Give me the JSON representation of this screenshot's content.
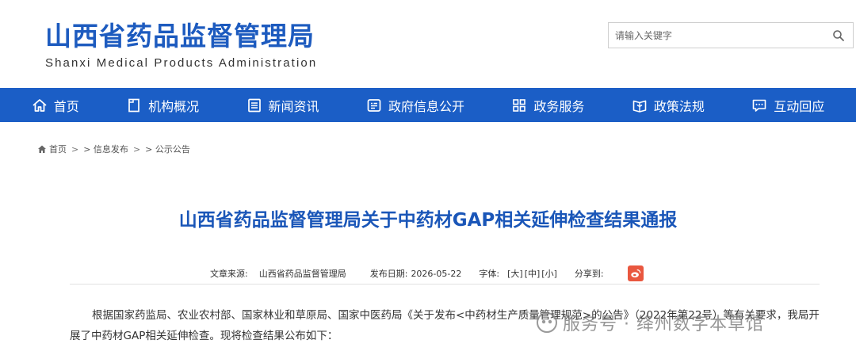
{
  "header": {
    "logo_cn": "山西省药品监督管理局",
    "logo_en": "Shanxi Medical Products Administration"
  },
  "search": {
    "placeholder": "请输入关键字",
    "icon": "search-icon"
  },
  "nav": {
    "items": [
      {
        "label": "首页",
        "icon": "home-icon"
      },
      {
        "label": "机构概况",
        "icon": "document-icon"
      },
      {
        "label": "新闻资讯",
        "icon": "news-icon"
      },
      {
        "label": "政府信息公开",
        "icon": "info-icon"
      },
      {
        "label": "政务服务",
        "icon": "grid-icon"
      },
      {
        "label": "政策法规",
        "icon": "book-icon"
      },
      {
        "label": "互动回应",
        "icon": "chat-icon"
      }
    ],
    "bg_color": "#1b5ec6"
  },
  "breadcrumb": {
    "home": "首页",
    "sep1": ">",
    "item1": "> 信息发布",
    "sep2": ">",
    "item2": "> 公示公告"
  },
  "article": {
    "title": "山西省药品监督管理局关于中药材GAP相关延伸检查结果通报",
    "source_label": "文章来源:",
    "source_value": "山西省药品监督管理局",
    "date_label": "发布日期:",
    "date_value": "2026-05-22",
    "font_label": "字体:",
    "font_large": "[大]",
    "font_medium": "[中]",
    "font_small": "[小]",
    "share_label": "分享到:",
    "body": "根据国家药监局、农业农村部、国家林业和草原局、国家中医药局《关于发布<中药材生产质量管理规范>的公告》（2022年第22号）等有关要求，我局开展了中药材GAP相关延伸检查。现将检查结果公布如下："
  },
  "watermark": {
    "text": "服务号 · 绛州数字本草馆"
  },
  "colors": {
    "brand_blue": "#1d5bbf",
    "title_blue": "#1a56b8",
    "weibo_red": "#e9573f"
  }
}
